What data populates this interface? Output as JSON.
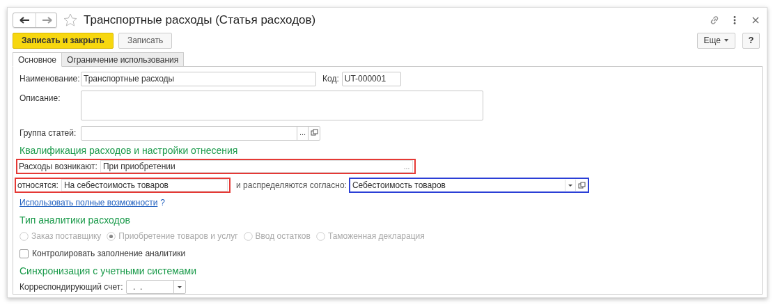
{
  "window": {
    "title": "Транспортные расходы (Статья расходов)",
    "favorite": false
  },
  "toolbar": {
    "primary": "Записать и закрыть",
    "secondary": "Записать",
    "more": "Еще",
    "help": "?"
  },
  "tabs": [
    {
      "label": "Основное",
      "selected": true
    },
    {
      "label": "Ограничение использования",
      "selected": false
    }
  ],
  "name": {
    "label": "Наименование:",
    "value": "Транспортные расходы"
  },
  "code": {
    "label": "Код:",
    "value": "UT-000001"
  },
  "description": {
    "label": "Описание:"
  },
  "group": {
    "label": "Группа статей:",
    "button": "..."
  },
  "section_1": "Квалификация расходов и настройки отнесения",
  "arise": {
    "label": "Расходы возникают:",
    "value": "При приобретении",
    "button": "...",
    "color": "#e53935"
  },
  "refer": {
    "label": "относятся:",
    "value": "На себестоимость товаров",
    "color": "#e53935"
  },
  "distribute": {
    "label": "и распределяются согласно:",
    "value": "Себестоимость товаров",
    "color": "#2b3fd6"
  },
  "link": {
    "text": "Использовать полные возможности",
    "help": "?"
  },
  "section_2": "Тип аналитики расходов",
  "analytics": [
    {
      "label": "Заказ поставщику",
      "selected": false,
      "disabled": true
    },
    {
      "label": "Приобретение товаров и услуг",
      "selected": true,
      "disabled": true
    },
    {
      "label": "Ввод остатков",
      "selected": false,
      "disabled": true
    },
    {
      "label": "Таможенная декларация",
      "selected": false,
      "disabled": true
    }
  ],
  "control": {
    "label": "Контролировать заполнение аналитики",
    "checked": false
  },
  "section_3": "Синхронизация с учетными системами",
  "account": {
    "label": "Корреспондирующий счет:",
    "value": " .  ."
  }
}
